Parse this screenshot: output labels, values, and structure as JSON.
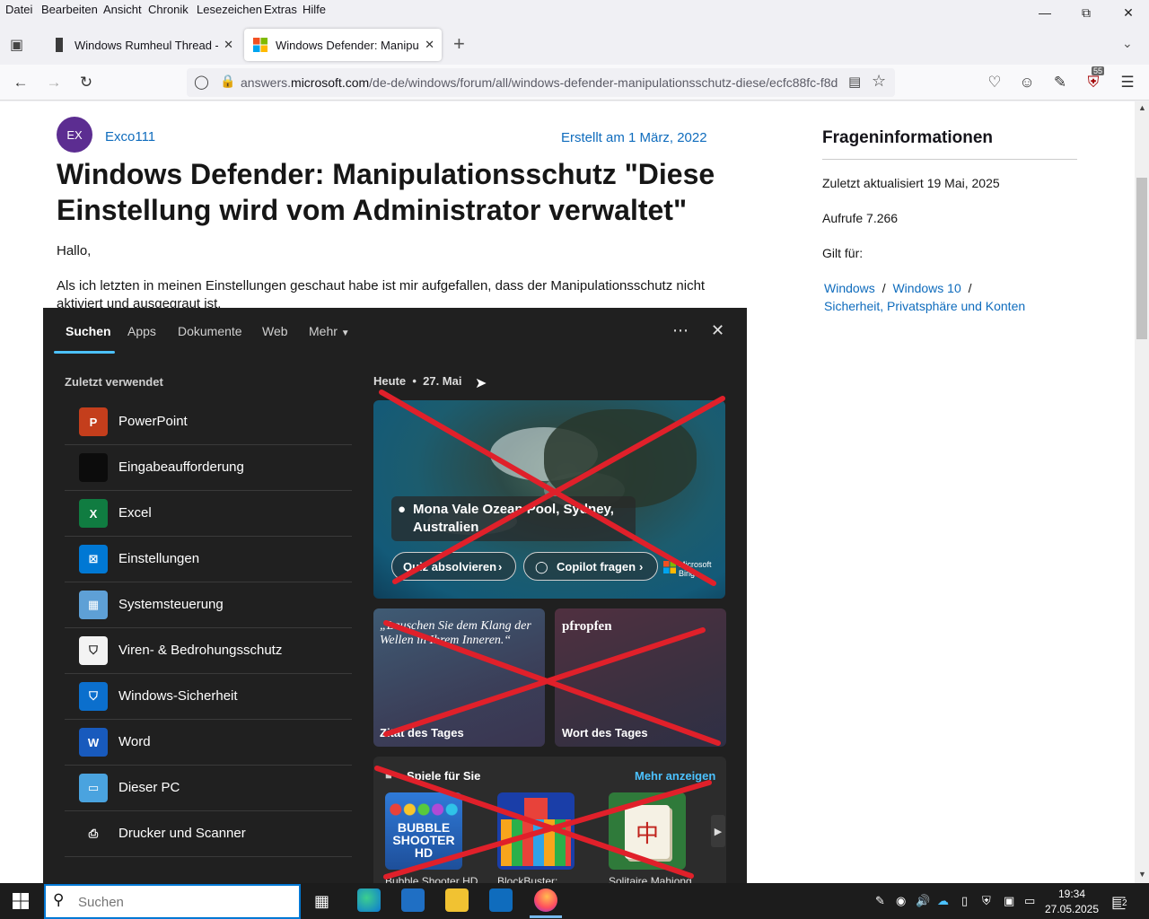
{
  "menubar": {
    "items": [
      "Datei",
      "Bearbeiten",
      "Ansicht",
      "Chronik",
      "Lesezeichen",
      "Extras",
      "Hilfe"
    ]
  },
  "tabs": [
    {
      "title": "Windows Rumheul Thread - Mil"
    },
    {
      "title": "Windows Defender: Manipulatio"
    }
  ],
  "url": {
    "prefix": "answers.",
    "domain": "microsoft.com",
    "path": "/de-de/windows/forum/all/windows-defender-manipulationsschutz-diese/ecfc88fc-f8d"
  },
  "badges": {
    "extension_count": "55"
  },
  "post": {
    "avatar": "EX",
    "author": "Exco111",
    "created": "Erstellt am 1 März, 2022",
    "title": "Windows Defender: Manipulationsschutz \"Diese Einstellung wird vom Administrator verwaltet\"",
    "greeting": "Hallo,",
    "body": "Als ich letzten in meinen Einstellungen geschaut habe ist mir aufgefallen, dass der Manipulationsschutz nicht aktiviert und ausgegraut ist."
  },
  "sidebar": {
    "heading": "Frageninformationen",
    "updated": "Zuletzt aktualisiert 19 Mai, 2025",
    "views": "Aufrufe 7.266",
    "applies": "Gilt für:",
    "links": [
      "Windows",
      "Windows 10",
      "Sicherheit, Privatsphäre und Konten"
    ],
    "separator": "/"
  },
  "search": {
    "tabs": [
      "Suchen",
      "Apps",
      "Dokumente",
      "Web",
      "Mehr"
    ],
    "recent_heading": "Zuletzt verwendet",
    "recent": [
      {
        "label": "PowerPoint",
        "icon": "powerpoint-icon",
        "color": "#c43e1c",
        "glyph": "P"
      },
      {
        "label": "Eingabeaufforderung",
        "icon": "cmd-icon",
        "color": "#0c0c0c",
        "glyph": ""
      },
      {
        "label": "Excel",
        "icon": "excel-icon",
        "color": "#107c41",
        "glyph": "X"
      },
      {
        "label": "Einstellungen",
        "icon": "settings-icon",
        "color": "#0078d4",
        "glyph": "⊠"
      },
      {
        "label": "Systemsteuerung",
        "icon": "control-panel-icon",
        "color": "#5ea0d6",
        "glyph": "▦"
      },
      {
        "label": "Viren- & Bedrohungsschutz",
        "icon": "shield-icon",
        "color": "#f3f3f3",
        "glyph": "⛉"
      },
      {
        "label": "Windows-Sicherheit",
        "icon": "windows-security-icon",
        "color": "#0b6fcd",
        "glyph": "⛉"
      },
      {
        "label": "Word",
        "icon": "word-icon",
        "color": "#185abd",
        "glyph": "W"
      },
      {
        "label": "Dieser PC",
        "icon": "this-pc-icon",
        "color": "#4aa3df",
        "glyph": "▭"
      },
      {
        "label": "Drucker und Scanner",
        "icon": "printer-icon",
        "color": "#202020",
        "glyph": "⎙"
      }
    ],
    "today": {
      "label": "Heute",
      "date": "27. Mai"
    },
    "hero": {
      "location": "Mona Vale Ozean Pool, Sydney, Australien",
      "quiz": "Quiz absolvieren",
      "copilot": "Copilot fragen",
      "brand": "Microsoft Bing"
    },
    "quote": {
      "text": "„Lauschen Sie dem Klang der Wellen in Ihrem Inneren.“",
      "footer": "Zitat des Tages"
    },
    "word": {
      "text": "pfropfen",
      "footer": "Wort des Tages"
    },
    "games": {
      "heading": "Spiele für Sie",
      "more": "Mehr anzeigen",
      "items": [
        {
          "label": "Bubble Shooter HD",
          "art": "BUBBLE SHOOTER HD"
        },
        {
          "label": "BlockBuster:",
          "art": ""
        },
        {
          "label": "Solitaire Mahjong",
          "art": "中"
        }
      ]
    }
  },
  "taskbar": {
    "search_placeholder": "Suchen",
    "time": "19:34",
    "date": "27.05.2025",
    "notifications": "2"
  }
}
